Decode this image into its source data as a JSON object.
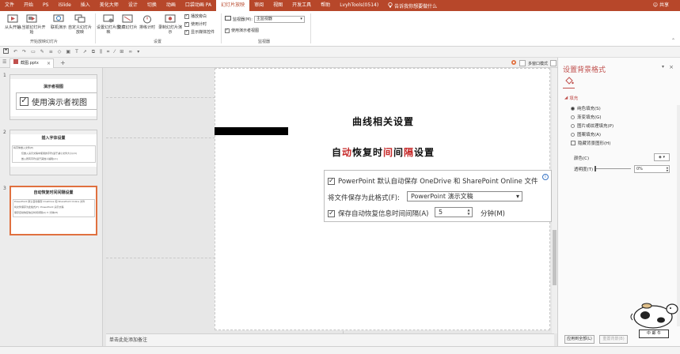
{
  "ribbon_tabs": [
    {
      "label": "文件"
    },
    {
      "label": "开始"
    },
    {
      "label": "PS"
    },
    {
      "label": "iSlide"
    },
    {
      "label": "插入"
    },
    {
      "label": "美化大师"
    },
    {
      "label": "设计"
    },
    {
      "label": "切换"
    },
    {
      "label": "动画"
    },
    {
      "label": "口袋动画 PA"
    },
    {
      "label": "幻灯片放映"
    },
    {
      "label": "审阅"
    },
    {
      "label": "视图"
    },
    {
      "label": "开发工具"
    },
    {
      "label": "帮助"
    },
    {
      "label": "LvyhTools(0514)"
    }
  ],
  "search_text": "告诉我你想要做什么",
  "share_label": "共享",
  "ribbon": {
    "from_start": "从头开始",
    "from_current": "从当前幻灯片开始",
    "online_present": "联机演示",
    "custom_show": "自定义幻灯片放映",
    "group_start": "开始放映幻灯片",
    "setup_show": "设置幻灯片放映",
    "hide_slide": "隐藏幻灯片",
    "rehearse": "排练计时",
    "record": "录制幻灯片演示",
    "group_setup": "设置",
    "play_narration": "播放旁白",
    "use_timings": "使用计时",
    "show_media": "显示媒体控件",
    "monitor_label": "监视器(M):",
    "monitor_value": "主监视器",
    "use_presenter": "使用演示者视图",
    "group_monitor": "监视器"
  },
  "doc_tab": "截图.pptx",
  "multi_window": "多窗口模式",
  "thumbnails": [
    {
      "num": "1",
      "title": "演示者视图",
      "check_label": "使用演示者视图"
    },
    {
      "num": "2",
      "title": "插入字体设置",
      "line1": "将字体嵌入文件(E)",
      "line2": "仅嵌入演示文稿中使用的字符(适于减小文件大小)(O)",
      "line3": "嵌入所有字符(适于其他人编辑)(C)"
    },
    {
      "num": "3",
      "title": "自动恢复时间间隔设置",
      "line1": "PowerPoint 默认自动保存 OneDrive 和 SharePoint Online 文件",
      "line2": "将文件保存为此格式(F): PowerPoint 演示文稿",
      "line3": "保存自动恢复信息时间间隔(A)  5  分钟(M)"
    }
  ],
  "slide": {
    "title1": "曲线相关设置",
    "title2_a": "自",
    "title2_b": "动",
    "title2_c": "恢复时",
    "title2_d": "间",
    "title2_e": "间",
    "title2_f": "隔",
    "title2_g": "设置",
    "option1": "PowerPoint 默认自动保存 OneDrive 和 SharePoint Online 文件",
    "option2_label": "将文件保存为此格式(F):",
    "option2_value": "PowerPoint 演示文稿",
    "option3_label": "保存自动恢复信息时间间隔(A)",
    "option3_value": "5",
    "option3_unit": "分钟(M)"
  },
  "notes_placeholder": "单击此处添加备注",
  "pane": {
    "title": "设置背景格式",
    "section": "填充",
    "fill_solid": "纯色填充(S)",
    "fill_gradient": "渐变填充(G)",
    "fill_picture": "图片或纹理填充(P)",
    "fill_pattern": "图案填充(A)",
    "hide_bg": "隐藏背景图形(H)",
    "color_label": "颜色(C)",
    "transparency_label": "透明度(T)",
    "transparency_value": "0%",
    "apply_all": "应用到全部(L)",
    "reset_bg": "重置背景(B)"
  },
  "mascot_tag": "中 邮 牛"
}
